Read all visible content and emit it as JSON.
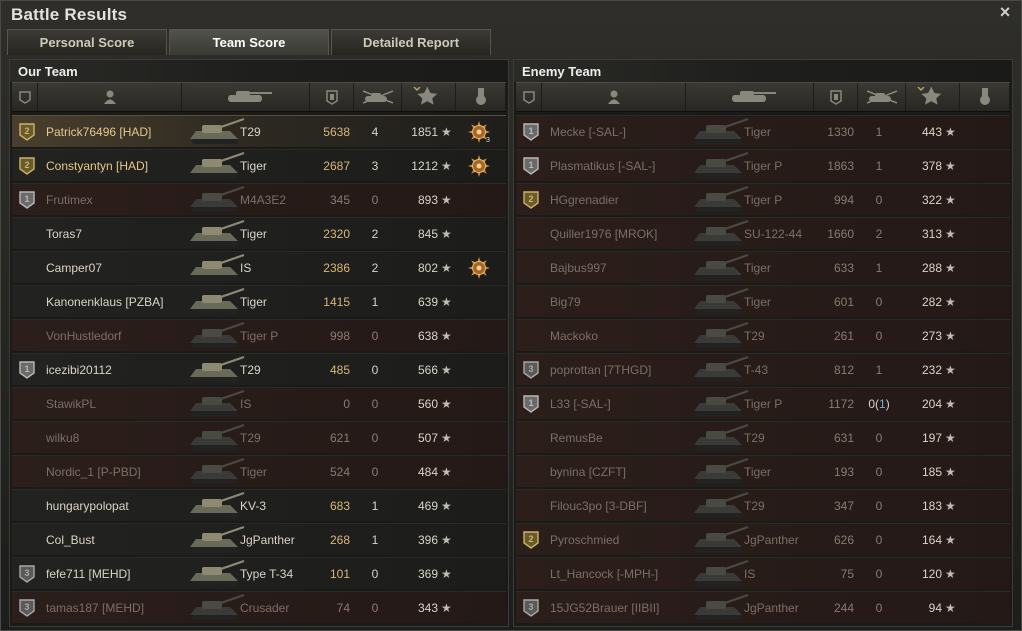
{
  "window": {
    "title": "Battle Results",
    "close_icon": "×"
  },
  "tabs": [
    {
      "label": "Personal Score",
      "active": false
    },
    {
      "label": "Team Score",
      "active": true
    },
    {
      "label": "Detailed Report",
      "active": false
    }
  ],
  "left": {
    "title": "Our Team",
    "rows": [
      {
        "name": "Patrick76496 [HAD]",
        "tank": "T29",
        "damage": "5638",
        "kills": "4",
        "xp": "1851",
        "badge": "2",
        "state": "self",
        "medal": "gold"
      },
      {
        "name": "Constyantyn [HAD]",
        "tank": "Tiger",
        "damage": "2687",
        "kills": "3",
        "xp": "1212",
        "badge": "2",
        "state": "alive-gold",
        "medal": "gold"
      },
      {
        "name": "Frutimex",
        "tank": "M4A3E2",
        "damage": "345",
        "kills": "0",
        "xp": "893",
        "badge": "1",
        "state": "dead",
        "medal": ""
      },
      {
        "name": "Toras7",
        "tank": "Tiger",
        "damage": "2320",
        "kills": "2",
        "xp": "845",
        "badge": "",
        "state": "alive",
        "medal": ""
      },
      {
        "name": "Camper07",
        "tank": "IS",
        "damage": "2386",
        "kills": "2",
        "xp": "802",
        "badge": "",
        "state": "alive",
        "medal": "gold"
      },
      {
        "name": "Kanonenklaus [PZBA]",
        "tank": "Tiger",
        "damage": "1415",
        "kills": "1",
        "xp": "639",
        "badge": "",
        "state": "alive",
        "medal": ""
      },
      {
        "name": "VonHustledorf",
        "tank": "Tiger P",
        "damage": "998",
        "kills": "0",
        "xp": "638",
        "badge": "",
        "state": "dead",
        "medal": ""
      },
      {
        "name": "icezibi20112",
        "tank": "T29",
        "damage": "485",
        "kills": "0",
        "xp": "566",
        "badge": "1",
        "state": "alive",
        "medal": ""
      },
      {
        "name": "StawikPL",
        "tank": "IS",
        "damage": "0",
        "kills": "0",
        "xp": "560",
        "badge": "",
        "state": "dead",
        "medal": ""
      },
      {
        "name": "wilku8",
        "tank": "T29",
        "damage": "621",
        "kills": "0",
        "xp": "507",
        "badge": "",
        "state": "dead",
        "medal": ""
      },
      {
        "name": "Nordic_1 [P-PBD]",
        "tank": "Tiger",
        "damage": "524",
        "kills": "0",
        "xp": "484",
        "badge": "",
        "state": "dead",
        "medal": ""
      },
      {
        "name": "hungarypolopat",
        "tank": "KV-3",
        "damage": "683",
        "kills": "1",
        "xp": "469",
        "badge": "",
        "state": "alive",
        "medal": ""
      },
      {
        "name": "Col_Bust",
        "tank": "JgPanther",
        "damage": "268",
        "kills": "1",
        "xp": "396",
        "badge": "",
        "state": "alive",
        "medal": ""
      },
      {
        "name": "fefe711 [MEHD]",
        "tank": "Type T-34",
        "damage": "101",
        "kills": "0",
        "xp": "369",
        "badge": "3",
        "state": "alive",
        "medal": ""
      },
      {
        "name": "tamas187 [MEHD]",
        "tank": "Crusader",
        "damage": "74",
        "kills": "0",
        "xp": "343",
        "badge": "3",
        "state": "dead",
        "medal": ""
      }
    ]
  },
  "right": {
    "title": "Enemy Team",
    "rows": [
      {
        "name": "Mecke [-SAL-]",
        "tank": "Tiger",
        "damage": "1330",
        "kills": "1",
        "assist": "",
        "xp": "443",
        "badge": "1",
        "state": "dead"
      },
      {
        "name": "Plasmatikus [-SAL-]",
        "tank": "Tiger P",
        "damage": "1863",
        "kills": "1",
        "assist": "",
        "xp": "378",
        "badge": "1",
        "state": "dead"
      },
      {
        "name": "HGgrenadier",
        "tank": "Tiger P",
        "damage": "994",
        "kills": "0",
        "assist": "",
        "xp": "322",
        "badge": "2",
        "state": "dead"
      },
      {
        "name": "Quiller1976 [MROK]",
        "tank": "SU-122-44",
        "damage": "1660",
        "kills": "2",
        "assist": "",
        "xp": "313",
        "badge": "",
        "state": "dead"
      },
      {
        "name": "Bajbus997",
        "tank": "Tiger",
        "damage": "633",
        "kills": "1",
        "assist": "",
        "xp": "288",
        "badge": "",
        "state": "dead"
      },
      {
        "name": "Big79",
        "tank": "Tiger",
        "damage": "601",
        "kills": "0",
        "assist": "",
        "xp": "282",
        "badge": "",
        "state": "dead"
      },
      {
        "name": "Mackoko",
        "tank": "T29",
        "damage": "261",
        "kills": "0",
        "assist": "",
        "xp": "273",
        "badge": "",
        "state": "dead"
      },
      {
        "name": "poprottan [7THGD]",
        "tank": "T-43",
        "damage": "812",
        "kills": "1",
        "assist": "",
        "xp": "232",
        "badge": "3",
        "state": "dead"
      },
      {
        "name": "L33 [-SAL-]",
        "tank": "Tiger P",
        "damage": "1172",
        "kills": "0",
        "assist": "1",
        "xp": "204",
        "badge": "1",
        "state": "dead"
      },
      {
        "name": "RemusBe",
        "tank": "T29",
        "damage": "631",
        "kills": "0",
        "assist": "",
        "xp": "197",
        "badge": "",
        "state": "dead"
      },
      {
        "name": "bynina [CZFT]",
        "tank": "Tiger",
        "damage": "193",
        "kills": "0",
        "assist": "",
        "xp": "185",
        "badge": "",
        "state": "dead"
      },
      {
        "name": "Filouc3po [3-DBF]",
        "tank": "T29",
        "damage": "347",
        "kills": "0",
        "assist": "",
        "xp": "183",
        "badge": "",
        "state": "dead"
      },
      {
        "name": "Pyroschmied",
        "tank": "JgPanther",
        "damage": "626",
        "kills": "0",
        "assist": "",
        "xp": "164",
        "badge": "2",
        "state": "dead"
      },
      {
        "name": "Lt_Hancock [-MPH-]",
        "tank": "IS",
        "damage": "75",
        "kills": "0",
        "assist": "",
        "xp": "120",
        "badge": "",
        "state": "dead"
      },
      {
        "name": "15JG52Brauer [IIBII]",
        "tank": "JgPanther",
        "damage": "244",
        "kills": "0",
        "assist": "",
        "xp": "94",
        "badge": "3",
        "state": "dead"
      }
    ]
  },
  "symbols": {
    "star": "★",
    "medal_count": "3"
  }
}
